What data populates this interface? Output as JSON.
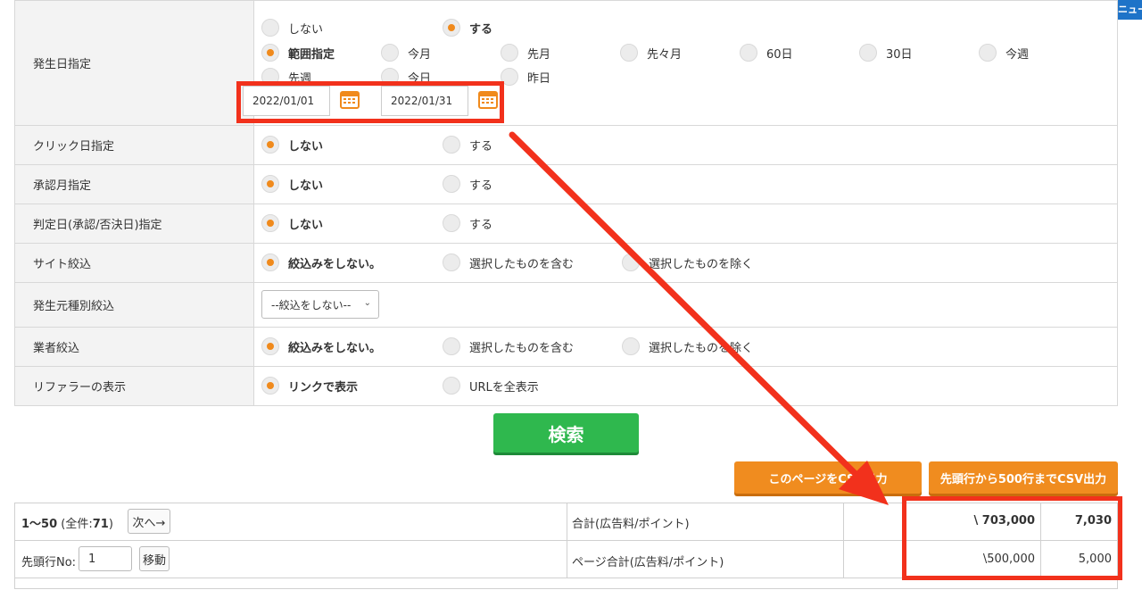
{
  "menu": {
    "label": "メニュー"
  },
  "rows": {
    "occurrence_date": {
      "label": "発生日指定"
    },
    "click_date": {
      "label": "クリック日指定"
    },
    "approval_month": {
      "label": "承認月指定"
    },
    "judgement_date": {
      "label": "判定日(承認/否決日)指定"
    },
    "site_filter": {
      "label": "サイト絞込"
    },
    "source_type_filter": {
      "label": "発生元種別絞込"
    },
    "vendor_filter": {
      "label": "業者絞込"
    },
    "referrer_display": {
      "label": "リファラーの表示"
    }
  },
  "occurrence": {
    "no": "しない",
    "yes": "する",
    "range": "範囲指定",
    "this_month": "今月",
    "last_month": "先月",
    "two_months_ago": "先々月",
    "days60": "60日",
    "days30": "30日",
    "this_week": "今週",
    "last_week": "先週",
    "today": "今日",
    "yesterday": "昨日",
    "date_from": "2022/01/01",
    "date_to": "2022/01/31"
  },
  "toggle": {
    "no": "しない",
    "yes": "する"
  },
  "site_opts": {
    "none": "絞込みをしない。",
    "include": "選択したものを含む",
    "exclude": "選択したものを除く"
  },
  "source_select": {
    "value": "--絞込をしない--"
  },
  "referrer_opts": {
    "link": "リンクで表示",
    "full": "URLを全表示"
  },
  "buttons": {
    "search": "検索",
    "csv_page": "このページをCSV出力",
    "csv_500": "先頭行から500行までCSV出力",
    "next": "次へ→",
    "move": "移動"
  },
  "results": {
    "range": "1〜50",
    "total_label": "(全件:",
    "total_count": "71",
    "total_close": ")",
    "head_row_label": "先頭行No:",
    "head_row_value": "1",
    "sum_label": "合計(広告料/ポイント)",
    "sum_fee": "\\ 703,000",
    "sum_points": "7,030",
    "page_sum_label": "ページ合計(広告料/ポイント)",
    "page_sum_fee": "\\500,000",
    "page_sum_points": "5,000"
  }
}
